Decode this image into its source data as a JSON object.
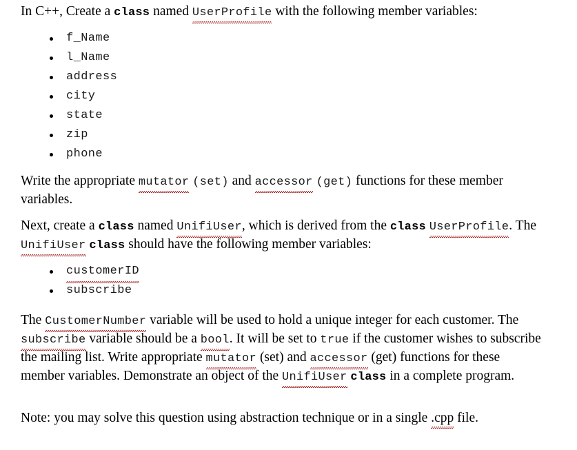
{
  "document": {
    "background_color": "#ffffff",
    "text_color": "#000000",
    "spellcheck_underline_color": "#a82626",
    "intro": {
      "seg1": "In C++, Create a ",
      "kw_class": "class",
      "seg2": " named ",
      "code_userprofile": "UserProfile",
      "seg3": " with the following member variables:"
    },
    "member_variables": [
      "f_Name",
      "l_Name",
      "address",
      "city",
      "state",
      "zip",
      "phone"
    ],
    "accessors_para": {
      "seg1": "Write the appropriate ",
      "code_mutator": "mutator",
      "seg2": " ",
      "code_set": "(set)",
      "seg3": " and ",
      "code_accessor": "accessor",
      "seg4": " ",
      "code_get": "(get)",
      "seg5": " functions for these member variables."
    },
    "derived_para": {
      "seg1": "Next, create a ",
      "kw_class1": "class",
      "seg2": " named ",
      "code_unifiuser1": "UnifiUser",
      "seg3": ", which is derived from the ",
      "kw_class2": "class",
      "seg4": " ",
      "code_userprofile": "UserProfile",
      "seg5": ". The ",
      "code_unifiuser2": "UnifiUser",
      "seg6": " ",
      "kw_class3": "class",
      "seg7": " should have the following member variables:"
    },
    "derived_members": [
      "customerID",
      "subscribe"
    ],
    "detail_para": {
      "seg1": "The ",
      "code_customernumber": "CustomerNumber",
      "seg2": " variable will be used to hold a unique integer for each customer. The ",
      "code_subscribe": "subscribe",
      "seg3": " variable should be a ",
      "code_bool": "bool",
      "seg4": ". It will be set to ",
      "code_true": "true",
      "seg5": " if the customer wishes to subscribe the mailing list. Write appropriate ",
      "code_mutator": "mutator",
      "seg6": " (set) and ",
      "code_accessor": "accessor",
      "seg7": " (get) functions for these member variables. Demonstrate an object of the ",
      "code_unifiuser": "UnifiUser",
      "seg8": " ",
      "kw_class": "class",
      "seg9": " in a complete program."
    },
    "note_para": {
      "seg1": "Note: you may solve this question using abstraction technique or in a single ",
      "code_cpp": ".cpp",
      "seg2": " file."
    }
  }
}
